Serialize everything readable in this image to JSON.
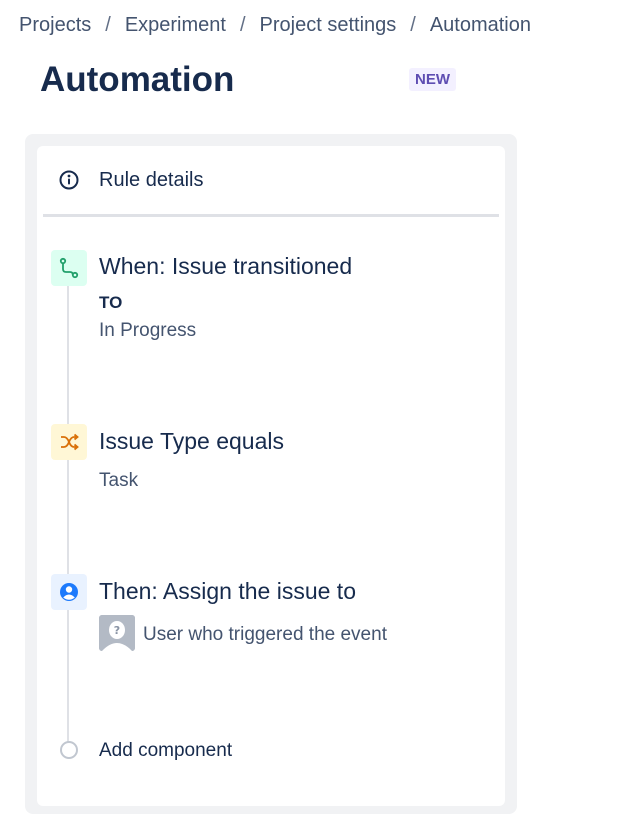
{
  "breadcrumb": {
    "items": [
      "Projects",
      "Experiment",
      "Project settings",
      "Automation"
    ],
    "separator": "/"
  },
  "page": {
    "title": "Automation",
    "badge": "NEW"
  },
  "rule": {
    "details_label": "Rule details",
    "trigger": {
      "title": "When: Issue transitioned",
      "to_label": "TO",
      "to_value": "In Progress",
      "icon": "branch-icon",
      "color": "#22a06b"
    },
    "condition": {
      "title": "Issue Type equals",
      "value": "Task",
      "icon": "shuffle-icon",
      "color": "#d97008"
    },
    "action": {
      "title": "Then: Assign the issue to",
      "value": "User who triggered the event",
      "icon": "user-circle-icon",
      "color": "#1d7afc"
    },
    "add_component": "Add component"
  }
}
